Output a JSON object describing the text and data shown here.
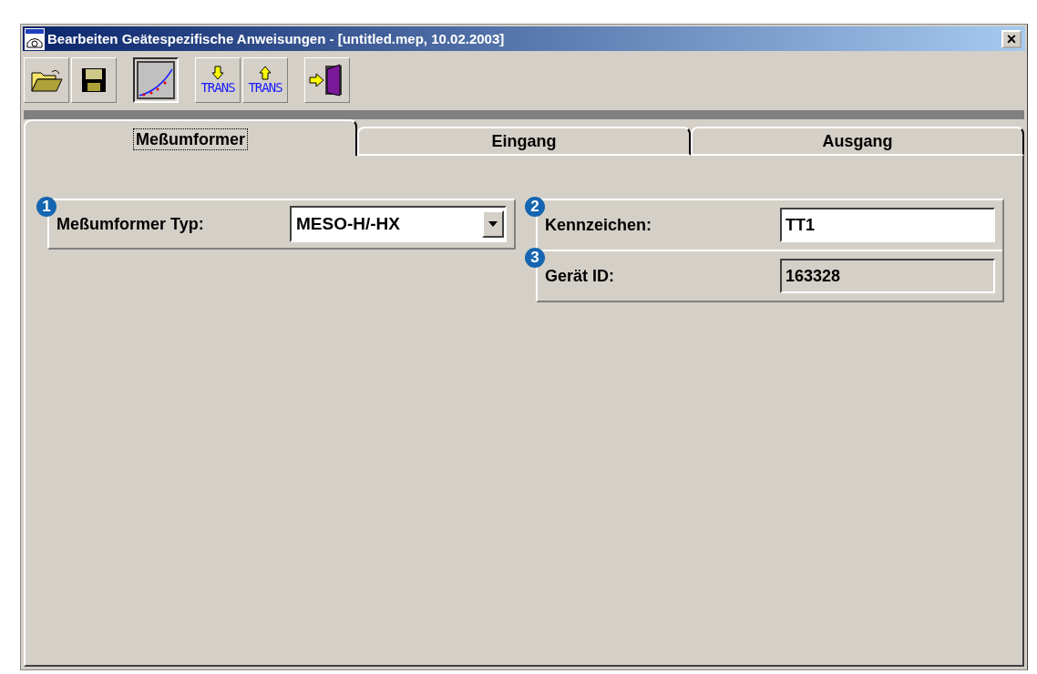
{
  "window": {
    "title": "Bearbeiten Geätespezifische Anweisungen - [untitled.mep, 10.02.2003]",
    "close": "×"
  },
  "toolbar": [
    {
      "kind": "open",
      "pressed": false
    },
    {
      "kind": "save",
      "pressed": false
    },
    {
      "kind": "chart",
      "pressed": true
    },
    {
      "kind": "download",
      "label": "TRANS",
      "pressed": false
    },
    {
      "kind": "upload",
      "label": "TRANS",
      "pressed": false
    },
    {
      "kind": "exit",
      "pressed": false
    }
  ],
  "tabs": [
    {
      "label": "Meßumformer",
      "selected": true
    },
    {
      "label": "Eingang",
      "selected": false
    },
    {
      "label": "Ausgang",
      "selected": false
    }
  ],
  "left_group": {
    "callout": "1",
    "label": "Meßumformer Typ:",
    "value": "MESO-H/-HX"
  },
  "right_group": [
    {
      "callout": "2",
      "label": "Kennzeichen:",
      "value": "TT1",
      "readonly": false
    },
    {
      "callout": "3",
      "label": "Gerät ID:",
      "value": "163328",
      "readonly": true
    }
  ]
}
